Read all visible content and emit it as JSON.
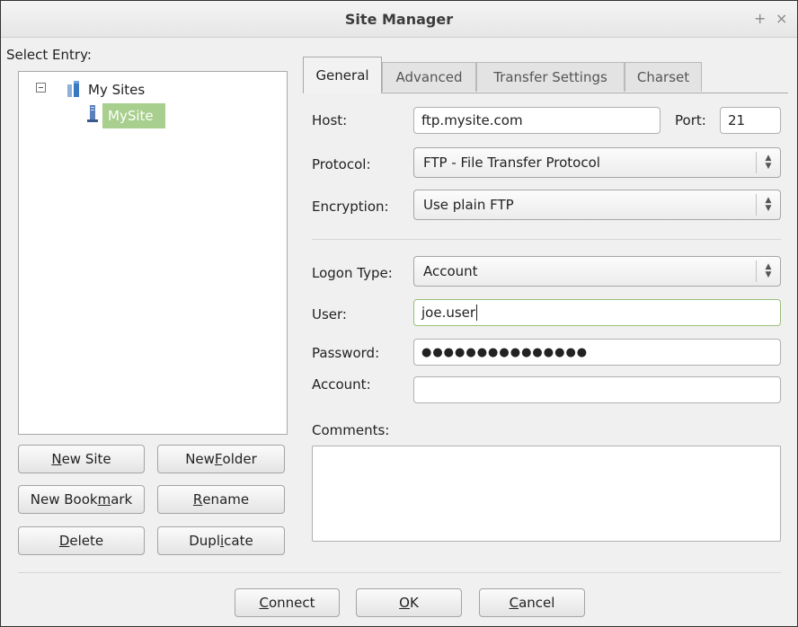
{
  "window": {
    "title": "Site Manager",
    "pin_glyph": "+",
    "close_glyph": "×"
  },
  "left": {
    "select_entry_label": "Select Entry:",
    "tree": {
      "root_label": "My Sites",
      "child_label": "MySite",
      "selected_color": "#a8cf8d"
    },
    "buttons": {
      "new_site": [
        "N",
        "ew Site"
      ],
      "new_folder": [
        "New ",
        "F",
        "older"
      ],
      "new_bookmark": [
        "New Book",
        "m",
        "ark"
      ],
      "rename": [
        "",
        "R",
        "ename"
      ],
      "delete": [
        "",
        "D",
        "elete"
      ],
      "duplicate": [
        "Dupl",
        "i",
        "cate"
      ]
    }
  },
  "tabs": [
    "General",
    "Advanced",
    "Transfer Settings",
    "Charset"
  ],
  "general": {
    "host_label": "Host:",
    "host_value": "ftp.mysite.com",
    "port_label": "Port:",
    "port_value": "21",
    "protocol_label": "Protocol:",
    "protocol_value": "FTP - File Transfer Protocol",
    "encryption_label": "Encryption:",
    "encryption_value": "Use plain FTP",
    "logon_type_label": "Logon Type:",
    "logon_type_value": "Account",
    "user_label": "User:",
    "user_value": "joe.user",
    "password_label": "Password:",
    "password_value": "●●●●●●●●●●●●●●●",
    "account_label": "Account:",
    "account_value": "",
    "comments_label": "Comments:",
    "comments_value": ""
  },
  "footer": {
    "connect": [
      "",
      "C",
      "onnect"
    ],
    "ok": [
      "",
      "O",
      "K"
    ],
    "cancel": [
      "",
      "C",
      "ancel"
    ]
  },
  "colors": {
    "focus_border": "#99c07a",
    "selection": "#a8cf8d"
  }
}
